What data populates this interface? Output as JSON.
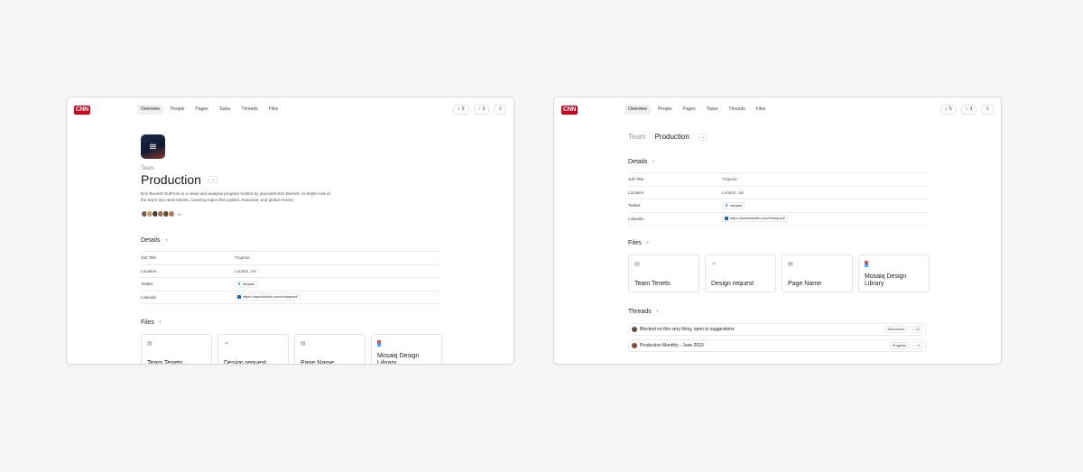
{
  "brand": {
    "logo_text": "CNN",
    "color": "#d0021b"
  },
  "nav": [
    "Overview",
    "People",
    "Pages",
    "Tasks",
    "Threads",
    "Files"
  ],
  "controls": {
    "count_a": "5",
    "count_b": "3"
  },
  "team": {
    "eyebrow": "Team",
    "title": "Production",
    "description": "Erin Burnett OutFront is a news and analysis program hosted by journalist Erin Burnett. In-depth look at the day's top news stories, covering topics like politics, business, and global events.",
    "more_members": "+4"
  },
  "breadcrumb": {
    "team": "Team",
    "current": "Production"
  },
  "details": {
    "heading": "Details",
    "rows": [
      {
        "key": "Job Title",
        "value": "Trapeze"
      },
      {
        "key": "Location",
        "value": "London, UK"
      },
      {
        "key": "Twitter",
        "value": "tarqrauf"
      },
      {
        "key": "Linkedin",
        "value": "https://www.linkedin.com/in/tarqrauf/"
      }
    ]
  },
  "files": {
    "heading": "Files",
    "items": [
      "Team Tenets",
      "Design request",
      "Page Name",
      "Mosaiq Design Library"
    ]
  },
  "threads": {
    "heading": "Threads",
    "items": [
      {
        "title": "Blocked on this very thing, open to suggestions",
        "tag": "Discussion",
        "count": "12"
      },
      {
        "title": "Production Monthly - June 2023",
        "tag": "Progress",
        "count": "4"
      }
    ]
  }
}
